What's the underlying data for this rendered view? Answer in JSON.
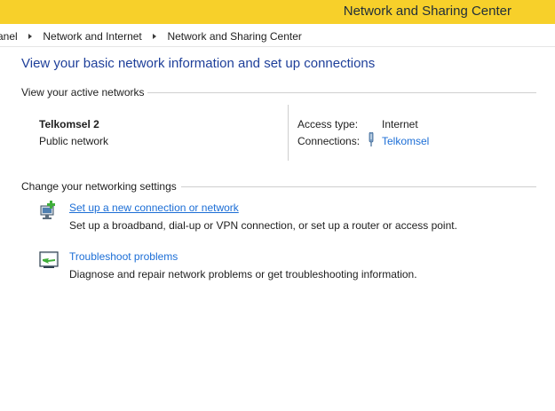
{
  "window": {
    "title": "Network and Sharing Center",
    "accent_color": "#f7d02a"
  },
  "breadcrumb": [
    "anel",
    "Network and Internet",
    "Network and Sharing Center"
  ],
  "main": {
    "headline": "View your basic network information and set up connections",
    "active_networks": {
      "label": "View your active networks",
      "network_name": "Telkomsel  2",
      "network_category": "Public network",
      "access_type_label": "Access type:",
      "access_type_value": "Internet",
      "connections_label": "Connections:",
      "connections_value": "Telkomsel",
      "connections_icon": "cellular-connection-icon"
    },
    "settings": {
      "label": "Change your networking settings",
      "tasks": [
        {
          "title": "Set up a new connection or network",
          "description": "Set up a broadband, dial-up or VPN connection, or set up a router or access point.",
          "icon": "new-connection-icon"
        },
        {
          "title": "Troubleshoot problems",
          "description": "Diagnose and repair network problems or get troubleshooting information.",
          "icon": "troubleshoot-icon"
        }
      ]
    }
  },
  "colors": {
    "link": "#1c6ed6",
    "headline": "#1e3f9a"
  }
}
